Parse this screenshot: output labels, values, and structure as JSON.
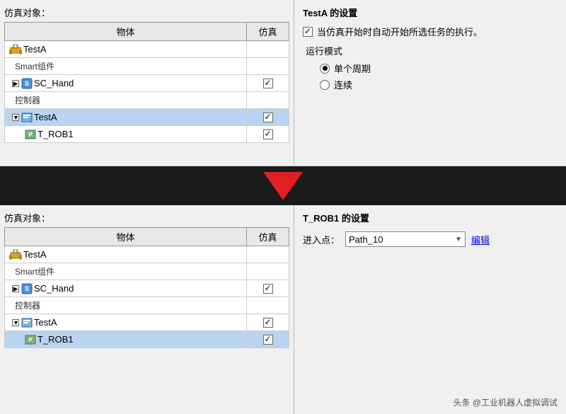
{
  "top": {
    "sim_label": "仿真对象：",
    "table": {
      "col1": "物体",
      "col2": "仿真",
      "rows": [
        {
          "indent": 0,
          "icon": "robot",
          "name": "TestA",
          "has_check": false,
          "checked": false,
          "highlight": false
        },
        {
          "indent": 1,
          "icon": null,
          "name": "Smart组件",
          "has_check": false,
          "checked": false,
          "highlight": false,
          "category": true
        },
        {
          "indent": 2,
          "icon": "component",
          "name": "SC_Hand",
          "has_check": true,
          "checked": true,
          "highlight": false,
          "expandable": true
        },
        {
          "indent": 1,
          "icon": null,
          "name": "控制器",
          "has_check": false,
          "checked": false,
          "highlight": false,
          "category": true
        },
        {
          "indent": 2,
          "icon": "task",
          "name": "TestA",
          "has_check": true,
          "checked": true,
          "highlight": true,
          "expand_open": true
        },
        {
          "indent": 3,
          "icon": "prog",
          "name": "T_ROB1",
          "has_check": true,
          "checked": true,
          "highlight": false
        }
      ]
    },
    "settings_title": "TestA 的设置",
    "checkbox_label": "当仿真开始时自动开始所选任务的执行。",
    "mode_label": "运行模式",
    "radio_options": [
      "单个周期",
      "连续"
    ],
    "selected_radio": 0
  },
  "arrow": {
    "symbol": "▼"
  },
  "bottom": {
    "sim_label": "仿真对象：",
    "table": {
      "col1": "物体",
      "col2": "仿真",
      "rows": [
        {
          "indent": 0,
          "icon": "robot",
          "name": "TestA",
          "has_check": false,
          "checked": false,
          "highlight": false
        },
        {
          "indent": 1,
          "icon": null,
          "name": "Smart组件",
          "has_check": false,
          "checked": false,
          "highlight": false,
          "category": true
        },
        {
          "indent": 2,
          "icon": "component",
          "name": "SC_Hand",
          "has_check": true,
          "checked": true,
          "highlight": false,
          "expandable": true
        },
        {
          "indent": 1,
          "icon": null,
          "name": "控制器",
          "has_check": false,
          "checked": false,
          "highlight": false,
          "category": true
        },
        {
          "indent": 2,
          "icon": "task",
          "name": "TestA",
          "has_check": true,
          "checked": true,
          "highlight": false,
          "expand_open": true
        },
        {
          "indent": 3,
          "icon": "prog",
          "name": "T_ROB1",
          "has_check": true,
          "checked": true,
          "highlight": true
        }
      ]
    },
    "settings_title": "T_ROB1 的设置",
    "entry_label": "进入点：",
    "entry_value": "Path_10",
    "edit_label": "编辑"
  },
  "watermark": "头条 @工业机器人虚拟调试"
}
